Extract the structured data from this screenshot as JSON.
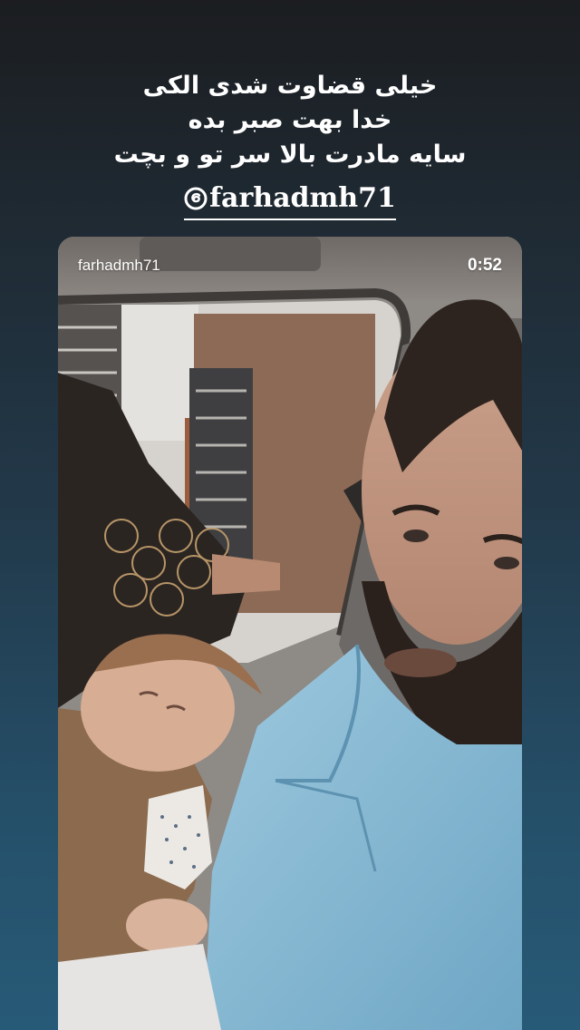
{
  "caption": {
    "lines": [
      "خیلی قضاوت شدی الکی",
      "خدا بهت صبر بده",
      "سایه مادرت بالا سر تو و بچت"
    ]
  },
  "mention": {
    "handle": "farhadmh71",
    "icon": "threads-logo-icon"
  },
  "video": {
    "username": "farhadmh71",
    "duration": "0:52"
  },
  "colors": {
    "background_top": "#1b1d20",
    "background_bottom": "#275a77",
    "text": "#ffffff",
    "shirt": "#86b9d4"
  }
}
